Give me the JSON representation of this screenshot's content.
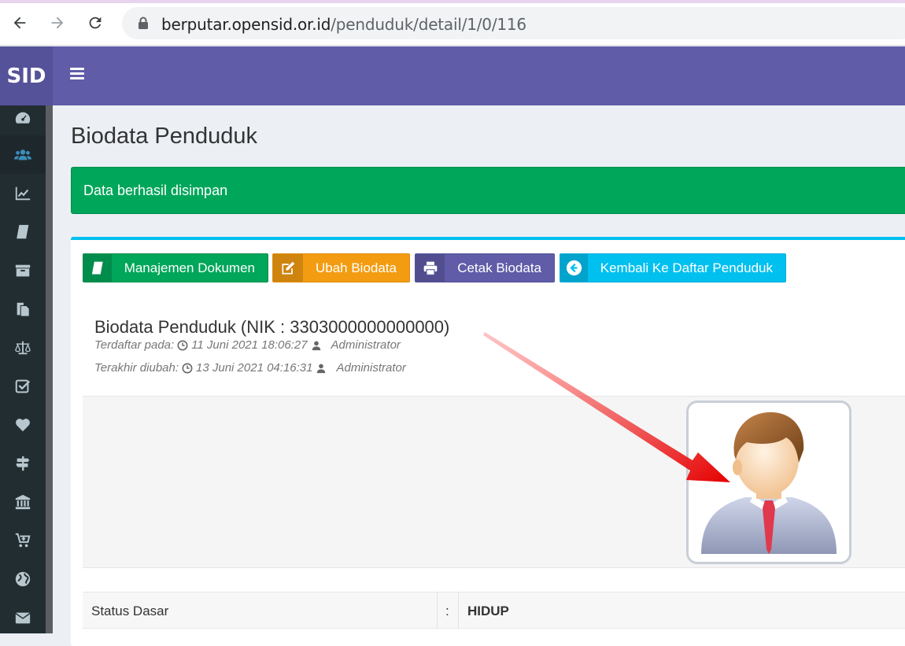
{
  "browser": {
    "url_host": "berputar.opensid.or.id",
    "url_path": "/penduduk/detail/1/0/116"
  },
  "header": {
    "logo": "SID"
  },
  "sidebar": {
    "items": [
      "dashboard",
      "penduduk",
      "statistik",
      "layanan-surat",
      "sekretariat",
      "keuangan",
      "hukum",
      "analisis",
      "bantuan",
      "pertanahan",
      "pembangunan",
      "lapak",
      "pemetaan",
      "kotak-pesan"
    ]
  },
  "page": {
    "title": "Biodata Penduduk"
  },
  "alert": {
    "message": "Data berhasil disimpan"
  },
  "toolbar": {
    "manage_docs": "Manajemen Dokumen",
    "edit_bio": "Ubah Biodata",
    "print_bio": "Cetak Biodata",
    "back": "Kembali Ke Daftar Penduduk"
  },
  "biodata": {
    "heading": "Biodata Penduduk (NIK : 3303000000000000)",
    "registered_label": "Terdaftar pada:",
    "registered_at": "11 Juni 2021 18:06:27",
    "registered_by": "Administrator",
    "updated_label": "Terakhir diubah:",
    "updated_at": "13 Juni 2021 04:16:31",
    "updated_by": "Administrator"
  },
  "details": {
    "status_label": "Status Dasar",
    "colon": ":",
    "status_value": "HIDUP"
  },
  "colors": {
    "brand": "#605ca8",
    "success": "#00a65a",
    "warning": "#f39c12",
    "info": "#00c0ef",
    "sidebar": "#222d32"
  }
}
